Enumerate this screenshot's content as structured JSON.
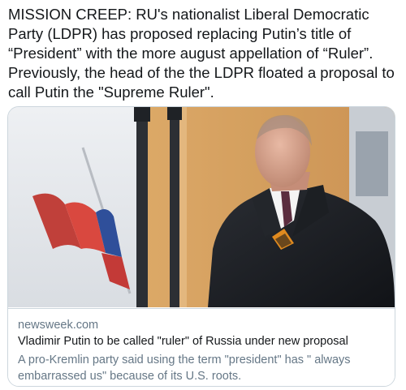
{
  "tweet": {
    "text": "MISSION CREEP:  RU's nationalist Liberal Democratic Party (LDPR) has proposed replacing Putin’s title of “President” with the more august appellation of “Ruler”. Previously, the head of the the LDPR floated a proposal to call Putin the \"Supreme Ruler\"."
  },
  "card": {
    "domain": "newsweek.com",
    "title": "Vladimir Putin to be called \"ruler\" of Russia under new proposal",
    "description": "A pro-Kremlin party said using the term \"president\" has \" always embarrassed us\" because of its U.S. roots."
  },
  "colors": {
    "text": "#14171a",
    "secondary_text": "#657786",
    "border": "#ccd6dd"
  }
}
